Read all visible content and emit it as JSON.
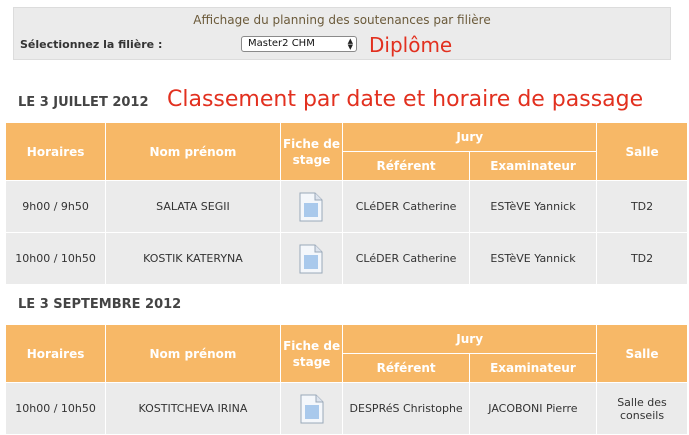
{
  "filter": {
    "title": "Affichage du planning des soutenances par filière",
    "label": "Sélectionnez la filière :",
    "selected": "Master2 CHM"
  },
  "annotations": {
    "diplome": "Diplôme",
    "classement": "Classement par date et horaire de passage"
  },
  "headers": {
    "horaires": "Horaires",
    "nom": "Nom prénom",
    "fiche": "Fiche de stage",
    "jury": "Jury",
    "referent": "Référent",
    "examinateur": "Examinateur",
    "salle": "Salle"
  },
  "sections": [
    {
      "date": "LE 3 JUILLET 2012",
      "rows": [
        {
          "horaires": "9h00 / 9h50",
          "nom": "SALATA SEGII",
          "referent": "CLéDER Catherine",
          "examinateur": "ESTèVE Yannick",
          "salle": "TD2"
        },
        {
          "horaires": "10h00 / 10h50",
          "nom": "KOSTIK KATERYNA",
          "referent": "CLéDER Catherine",
          "examinateur": "ESTèVE Yannick",
          "salle": "TD2"
        }
      ]
    },
    {
      "date": "LE 3 SEPTEMBRE 2012",
      "rows": [
        {
          "horaires": "10h00 / 10h50",
          "nom": "KOSTITCHEVA IRINA",
          "referent": "DESPRéS Christophe",
          "examinateur": "JACOBONI Pierre",
          "salle": "Salle des conseils"
        }
      ]
    }
  ],
  "colors": {
    "header": "#f7b867",
    "cell": "#ebebeb",
    "annotation": "#e2301f"
  },
  "icons": {
    "fiche": "document-icon"
  }
}
